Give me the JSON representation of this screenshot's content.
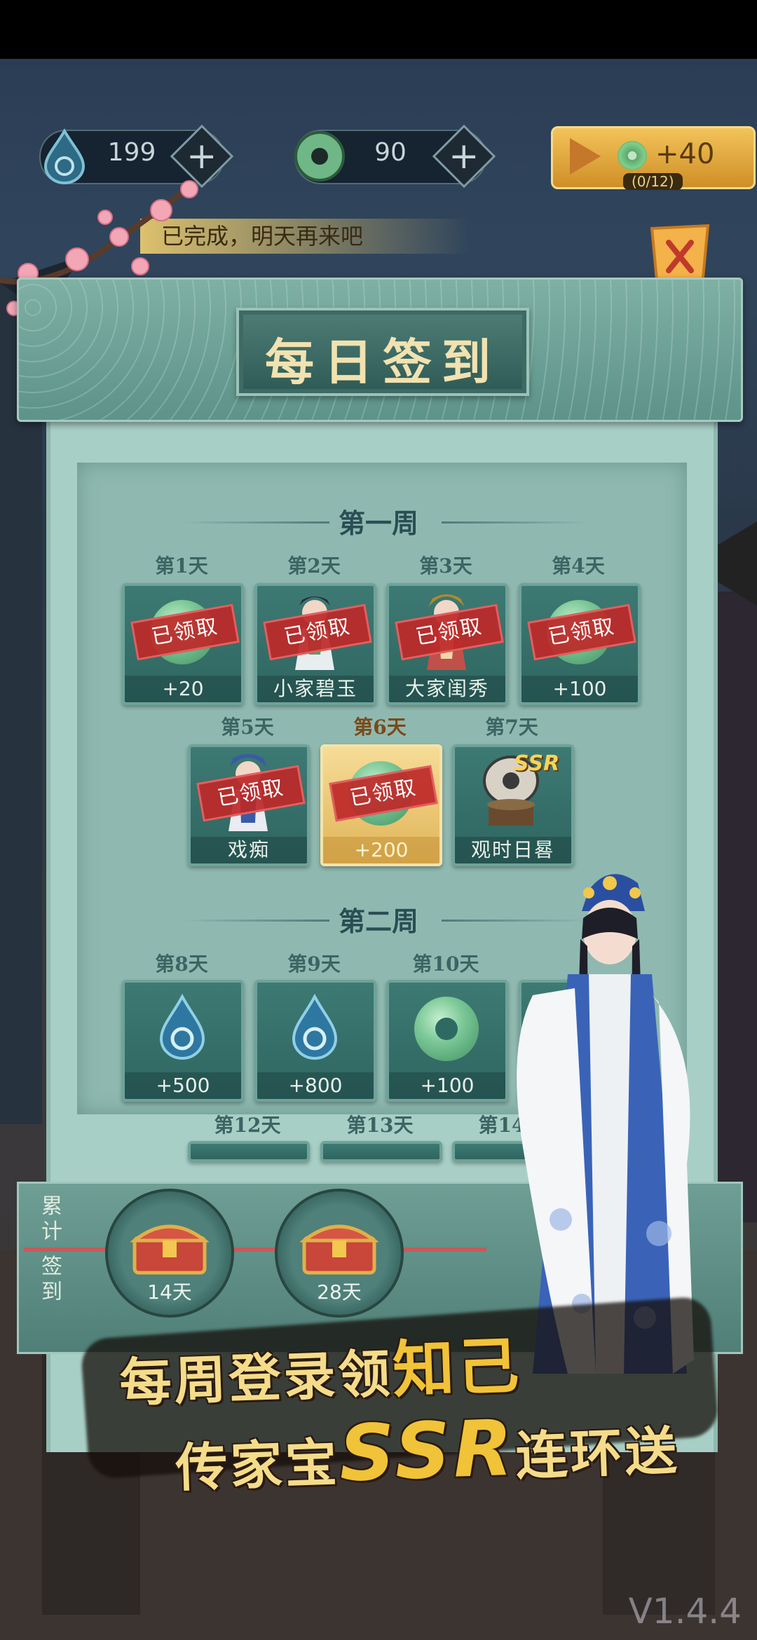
{
  "resources": [
    {
      "icon": "water-drop-icon",
      "value": "199"
    },
    {
      "icon": "jade-coin-icon",
      "value": "90"
    }
  ],
  "ad_button": {
    "reward": "+40",
    "progress": "(0/12)"
  },
  "notice": "已完成，明天再来吧",
  "title": "每日签到",
  "weeks": [
    {
      "label": "第一周",
      "days": [
        {
          "day": "第1天",
          "reward": "+20",
          "icon": "jade-coin-icon",
          "claimed": true,
          "stamp": "已领取"
        },
        {
          "day": "第2天",
          "reward": "小家碧玉",
          "icon": "opera-figure-icon",
          "claimed": true,
          "stamp": "已领取"
        },
        {
          "day": "第3天",
          "reward": "大家闺秀",
          "icon": "opera-figure-icon",
          "claimed": true,
          "stamp": "已领取"
        },
        {
          "day": "第4天",
          "reward": "+100",
          "icon": "jade-coin-icon",
          "claimed": true,
          "stamp": "已领取"
        },
        {
          "day": "第5天",
          "reward": "戏痴",
          "icon": "opera-figure-icon",
          "claimed": true,
          "stamp": "已领取"
        },
        {
          "day": "第6天",
          "reward": "+200",
          "icon": "jade-coin-icon",
          "claimed": true,
          "stamp": "已领取",
          "highlight": true
        },
        {
          "day": "第7天",
          "reward": "观时日晷",
          "icon": "sundial-icon",
          "badge": "SSR"
        }
      ]
    },
    {
      "label": "第二周",
      "days": [
        {
          "day": "第8天",
          "reward": "+500",
          "icon": "water-drop-icon"
        },
        {
          "day": "第9天",
          "reward": "+800",
          "icon": "water-drop-icon"
        },
        {
          "day": "第10天",
          "reward": "+100",
          "icon": "jade-ring-icon"
        },
        {
          "day": "第12天"
        },
        {
          "day": "第13天"
        },
        {
          "day": "第14天"
        }
      ]
    }
  ],
  "cumulative": {
    "label_top": "累计",
    "label_bottom": "签到",
    "milestones": [
      "14天",
      "28天"
    ]
  },
  "promo": {
    "line1_a": "每周登录领",
    "line1_b": "知己",
    "line2_a": "传家宝",
    "line2_b": "SSR",
    "line2_c": "连环送"
  },
  "version": "V1.4.4",
  "colors": {
    "panel": "#5d938a",
    "paper": "#a8cfc6",
    "card": "#3d7a73",
    "stamp": "#be2828",
    "gold": "#f0c338"
  }
}
